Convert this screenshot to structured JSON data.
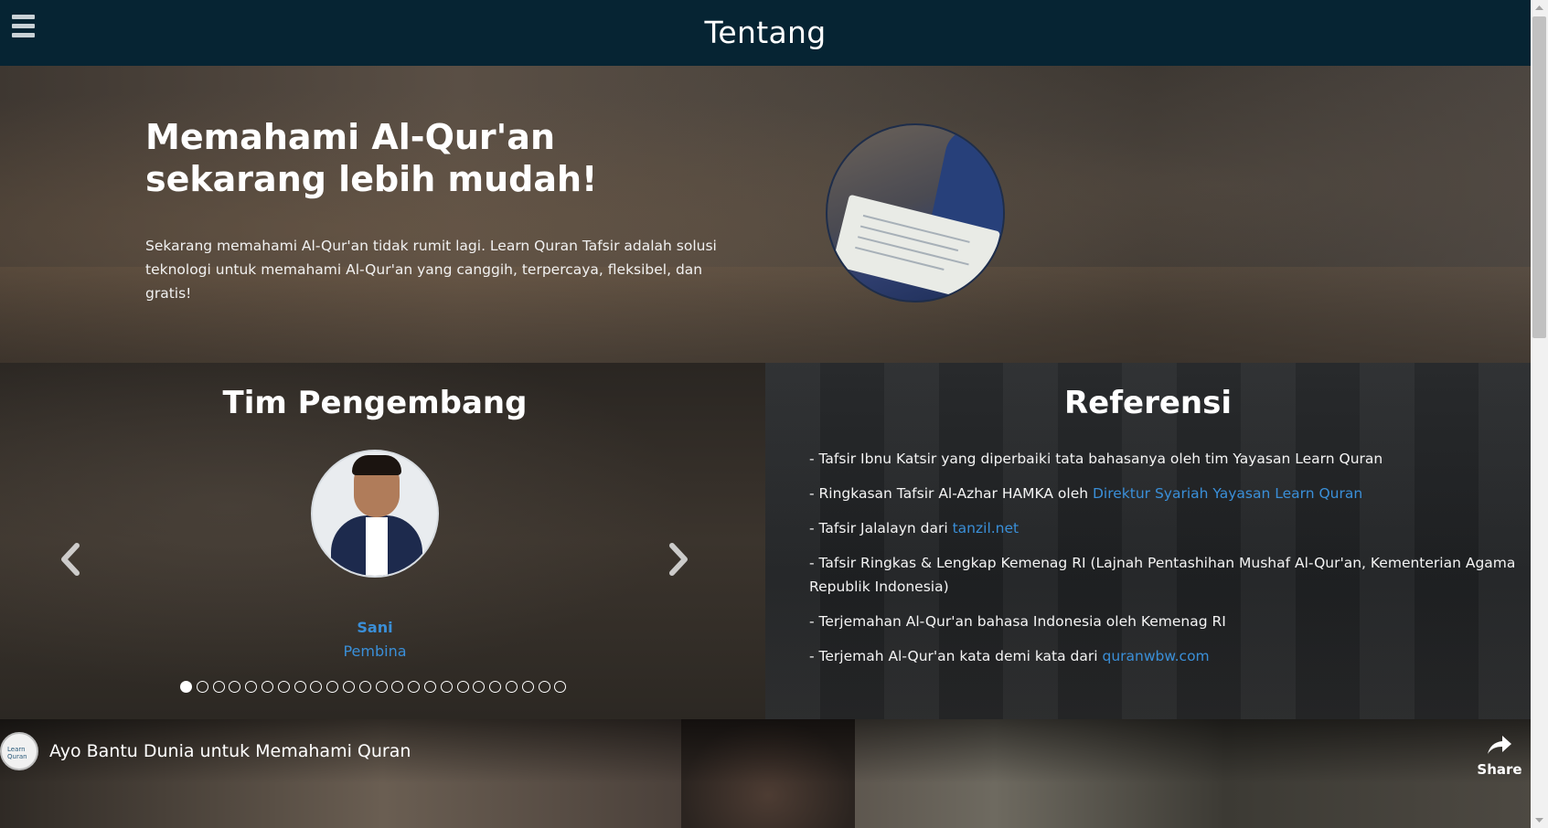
{
  "navbar": {
    "title": "Tentang",
    "menu_icon": "hamburger-menu-icon"
  },
  "hero": {
    "heading": "Memahami Al-Qur'an sekarang lebih mudah!",
    "text": "Sekarang memahami Al-Qur'an tidak rumit lagi. Learn Quran Tafsir adalah solusi teknologi untuk memahami Al-Qur'an yang canggih, terpercaya, fleksibel, dan gratis!"
  },
  "team": {
    "title": "Tim Pengembang",
    "member": {
      "name": "Sani",
      "role": "Pembina"
    },
    "slide_count": 24,
    "active_slide": 1,
    "prev_icon": "chevron-left-icon",
    "next_icon": "chevron-right-icon"
  },
  "references": {
    "title": "Referensi",
    "items": [
      {
        "text": "- Tafsir Ibnu Katsir yang diperbaiki tata bahasanya oleh tim Yayasan Learn Quran",
        "link": ""
      },
      {
        "text": "- Ringkasan Tafsir Al-Azhar HAMKA oleh ",
        "link": "Direktur Syariah Yayasan Learn Quran"
      },
      {
        "text": "- Tafsir Jalalayn dari ",
        "link": "tanzil.net"
      },
      {
        "text": "- Tafsir Ringkas & Lengkap Kemenag RI (Lajnah Pentashihan Mushaf Al-Qur'an, Kementerian Agama Republik Indonesia)",
        "link": ""
      },
      {
        "text": "- Terjemahan Al-Qur'an bahasa Indonesia oleh Kemenag RI",
        "link": ""
      },
      {
        "text": "- Terjemah Al-Qur'an kata demi kata dari ",
        "link": "quranwbw.com"
      }
    ]
  },
  "video": {
    "title": "Ayo Bantu Dunia untuk Memahami Quran",
    "channel_logo_text": "Learn Quran",
    "share_label": "Share",
    "share_icon": "share-arrow-icon"
  },
  "colors": {
    "navbar_bg": "#062433",
    "link": "#3a8fd8"
  }
}
